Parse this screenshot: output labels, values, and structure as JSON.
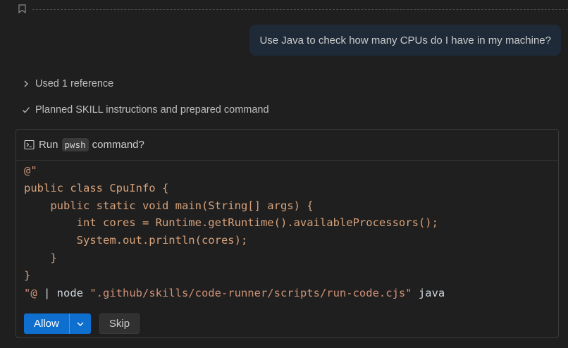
{
  "user_message": "Use Java to check how many CPUs do I have in my machine?",
  "steps": [
    {
      "label": "Used 1 reference",
      "icon": "chevron-right-icon"
    },
    {
      "label": "Planned SKILL instructions and prepared command",
      "icon": "check-icon"
    }
  ],
  "confirm": {
    "prefix": "Run",
    "shell": "pwsh",
    "suffix": "command?",
    "code_lines": [
      "@\"",
      "public class CpuInfo {",
      "    public static void main(String[] args) {",
      "        int cores = Runtime.getRuntime().availableProcessors();",
      "        System.out.println(cores);",
      "    }",
      "}",
      "\"@ | node \".github/skills/code-runner/scripts/run-code.cjs\" java"
    ],
    "allow_label": "Allow",
    "skip_label": "Skip"
  },
  "colors": {
    "background": "#1f1f1f",
    "user_bubble": "#1e2a37",
    "primary_button": "#0e6fce"
  }
}
